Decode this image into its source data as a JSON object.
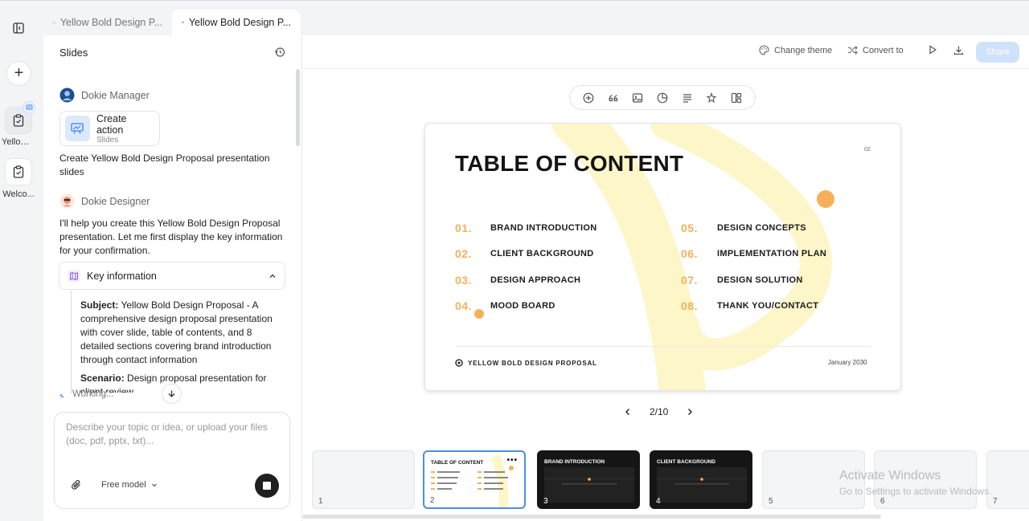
{
  "tabs": [
    {
      "label": "Yellow Bold Design P...",
      "icon": "history-icon"
    },
    {
      "label": "Yellow Bold Design P...",
      "icon": "presentation-icon"
    }
  ],
  "rail": {
    "docs": [
      {
        "label": "Yellow ...",
        "icon": "clipboard-icon"
      },
      {
        "label": "Welco...",
        "icon": "clipboard-icon"
      }
    ]
  },
  "panel": {
    "title": "Slides",
    "manager": {
      "name": "Dokie Manager"
    },
    "action_card": {
      "title": "Create action",
      "subtitle": "Slides"
    },
    "manager_text": "Create Yellow Bold Design Proposal presentation slides",
    "designer": {
      "name": "Dokie Designer"
    },
    "designer_text": "I'll help you create this Yellow Bold Design Proposal presentation. Let me first display the key information for your confirmation.",
    "key_info": {
      "label": "Key information",
      "subject_key": "Subject:",
      "subject_value": "Yellow Bold Design Proposal - A comprehensive design proposal presentation with cover slide, table of contents, and 8 detailed sections covering brand introduction through contact information",
      "scenario_key": "Scenario:",
      "scenario_value": "Design proposal presentation for client review"
    },
    "working": "Working..."
  },
  "composer": {
    "placeholder": "Describe your topic or idea, or upload your files (doc, pdf, pptx, txt)...",
    "model": "Free model"
  },
  "toolbar": {
    "change_theme": "Change theme",
    "convert_to": "Convert to",
    "share": "Share"
  },
  "slide": {
    "title": "TABLE OF CONTENT",
    "page_no": "02",
    "items": [
      {
        "num": "01.",
        "label": "BRAND INTRODUCTION"
      },
      {
        "num": "02.",
        "label": "CLIENT BACKGROUND"
      },
      {
        "num": "03.",
        "label": "DESIGN APPROACH"
      },
      {
        "num": "04.",
        "label": "MOOD BOARD"
      },
      {
        "num": "05.",
        "label": "DESIGN CONCEPTS"
      },
      {
        "num": "06.",
        "label": "IMPLEMENTATION PLAN"
      },
      {
        "num": "07.",
        "label": "DESIGN SOLUTION"
      },
      {
        "num": "08.",
        "label": "THANK YOU/CONTACT"
      }
    ],
    "footer": "YELLOW BOLD DESIGN PROPOSAL",
    "date": "January 2030",
    "accent": "#f6b05a",
    "deco_color": "#fdf6c9"
  },
  "pager": {
    "current": "2/10"
  },
  "thumbs": [
    {
      "num": "1",
      "title": ""
    },
    {
      "num": "2",
      "title": "TABLE OF CONTENT"
    },
    {
      "num": "3",
      "title": "BRAND INTRODUCTION"
    },
    {
      "num": "4",
      "title": "CLIENT BACKGROUND"
    },
    {
      "num": "5",
      "title": ""
    },
    {
      "num": "6",
      "title": ""
    },
    {
      "num": "7",
      "title": ""
    }
  ],
  "watermark": {
    "line1": "Activate Windows",
    "line2": "Go to Settings to activate Windows."
  }
}
